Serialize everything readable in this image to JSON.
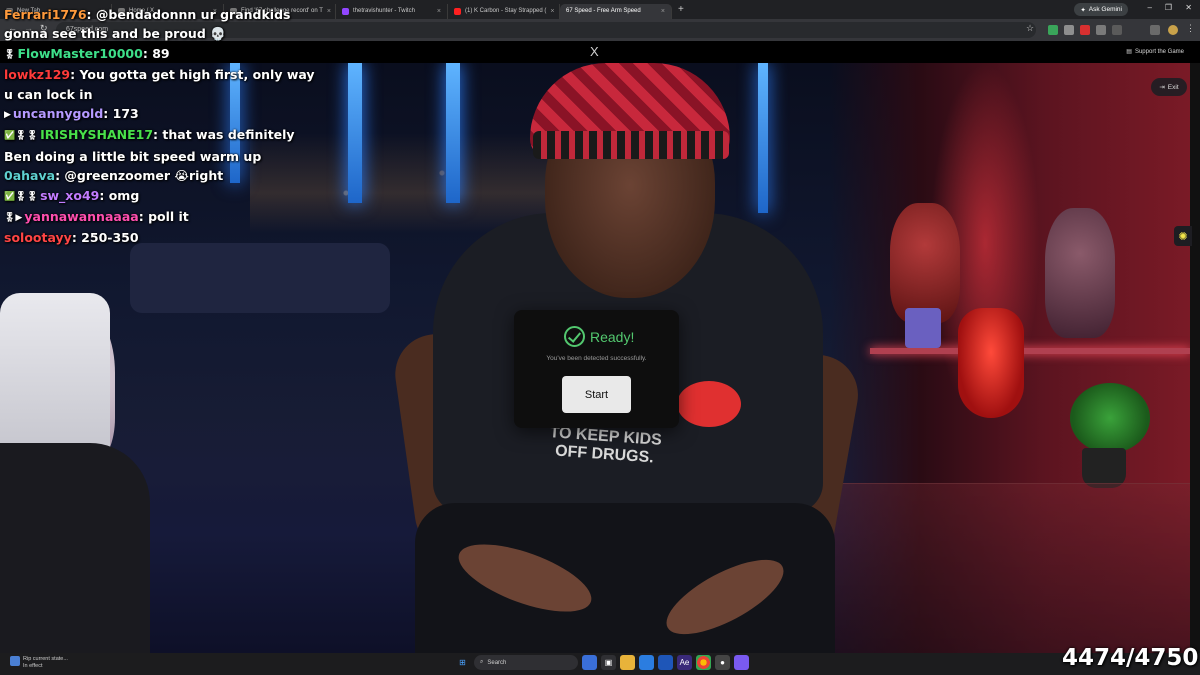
{
  "browser": {
    "tabs": [
      {
        "label": "New Tab",
        "active": false
      },
      {
        "label": "Home / X",
        "active": false
      },
      {
        "label": "Find '67 challenge record' on T",
        "active": false
      },
      {
        "label": "thetravishunter - Twitch",
        "active": false
      },
      {
        "label": "(1) K Carbon - Stay Strapped (",
        "active": false
      },
      {
        "label": "67 Speed - Free Arm Speed",
        "active": true
      }
    ],
    "new_tab_glyph": "+",
    "ask_gemini": "Ask Gemini",
    "address": "67speed.com"
  },
  "site": {
    "x_glyph": "X",
    "support_label": "Support the Game",
    "exit_label": "Exit",
    "side_tool_icon": "sun-icon"
  },
  "chat": {
    "messages": [
      {
        "badges": "",
        "user": "Ferrari1776",
        "color": "#ff9a3c",
        "text": "@bendadonnn ur grandkids"
      },
      {
        "badges": "",
        "user": "",
        "color": "#ffffff",
        "text": "gonna see this and be proud 💀"
      },
      {
        "badges": "🎖",
        "user": "FlowMaster10000",
        "color": "#3ee08a",
        "text": "89"
      },
      {
        "badges": "",
        "user": "lowkz129",
        "color": "#ff3b3b",
        "text": "You gotta get high first, only way"
      },
      {
        "badges": "",
        "user": "",
        "color": "#ffffff",
        "text": "u can lock in"
      },
      {
        "badges": "▶",
        "user": "uncannygold",
        "color": "#b59aff",
        "text": "173"
      },
      {
        "badges": "✅🎖🎖",
        "user": "IRISHYSHANE17",
        "color": "#49e04a",
        "text": "that was definitely"
      },
      {
        "badges": "",
        "user": "",
        "color": "#ffffff",
        "text": "Ben doing a little bit speed warm up"
      },
      {
        "badges": "",
        "user": "0ahava",
        "color": "#5fd0d0",
        "text": "@greenzoomer 😭right"
      },
      {
        "badges": "✅🎖🎖",
        "user": "sw_xo49",
        "color": "#c27cff",
        "text": "omg"
      },
      {
        "badges": "🎖▶",
        "user": "yannawannaaaa",
        "color": "#ff4fb0",
        "text": "poll it"
      },
      {
        "badges": "",
        "user": "solootayy",
        "color": "#ff4545",
        "text": "250-350"
      }
    ]
  },
  "modal": {
    "title": "Ready!",
    "subtitle": "You've been detected successfully.",
    "start_label": "Start",
    "accent": "#53c86f"
  },
  "counter": "4474/4750",
  "taskbar": {
    "status_line1": "Rip current state...",
    "status_line2": "In effect",
    "search_placeholder": "Search"
  }
}
